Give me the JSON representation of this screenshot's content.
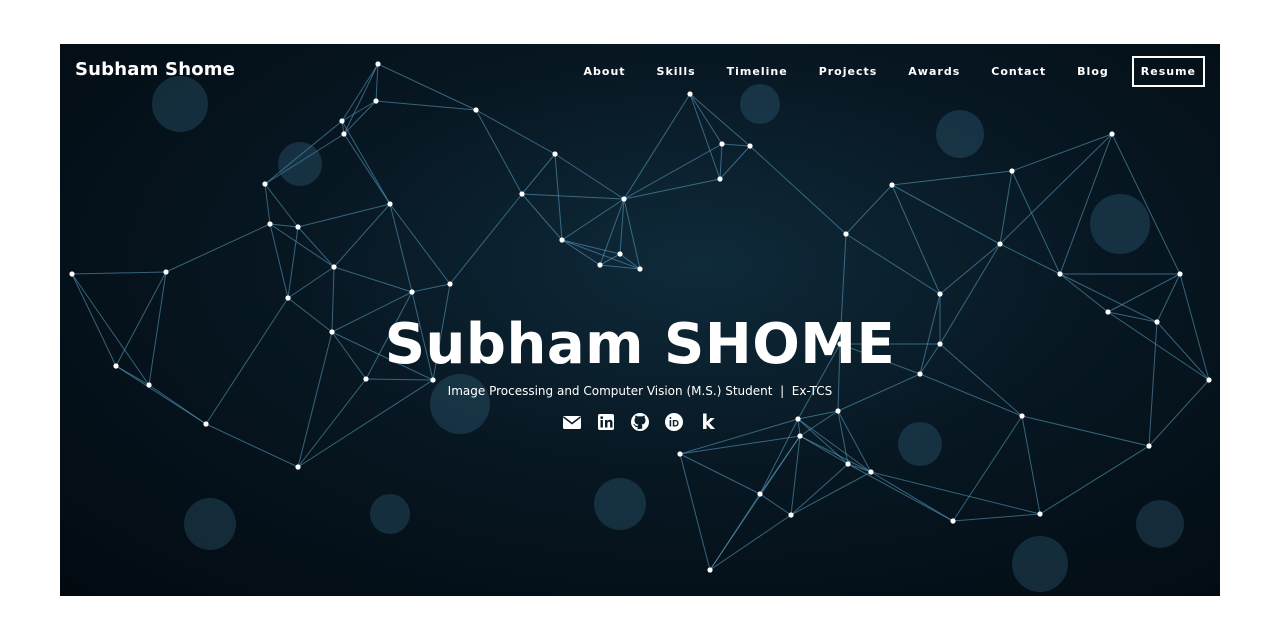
{
  "navbar": {
    "brand": "Subham Shome",
    "links": [
      {
        "label": "About"
      },
      {
        "label": "Skills"
      },
      {
        "label": "Timeline"
      },
      {
        "label": "Projects"
      },
      {
        "label": "Awards"
      },
      {
        "label": "Contact"
      },
      {
        "label": "Blog"
      }
    ],
    "resume_label": "Resume"
  },
  "hero": {
    "title": "Subham SHOME",
    "subtitle": "Image Processing and Computer Vision (M.S.) Student  |  Ex-TCS",
    "social_icons": [
      "envelope-icon",
      "linkedin-icon",
      "github-icon",
      "orcid-icon",
      "kaggle-icon"
    ],
    "kaggle_glyph": "k"
  },
  "colors": {
    "background_dark": "#071722",
    "network_line": "#5fa6c9",
    "text": "#ffffff",
    "page_margin": "#ffffff"
  }
}
